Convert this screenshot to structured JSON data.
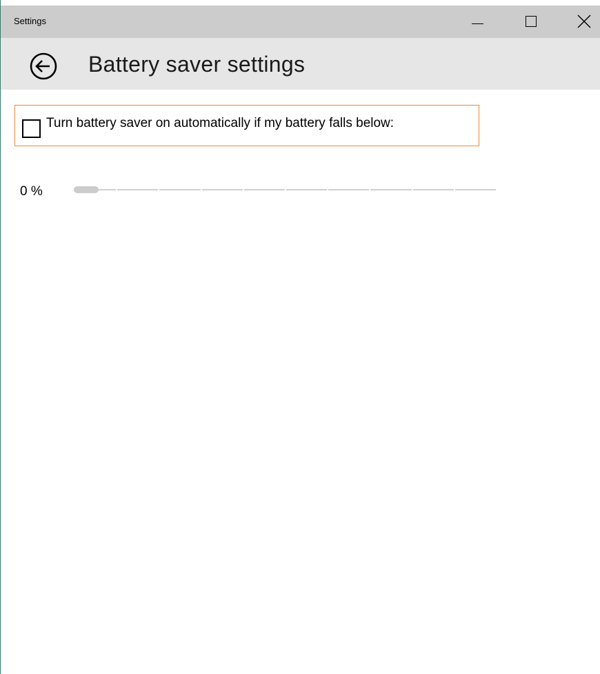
{
  "window": {
    "title": "Settings"
  },
  "header": {
    "title": "Battery saver settings"
  },
  "options": {
    "auto_on_label": "Turn battery saver on automatically if my battery falls below:",
    "auto_on_checked": false
  },
  "slider": {
    "value_label": "0 %",
    "value_percent": 0,
    "min": 0,
    "max": 100,
    "tick_step": 10
  },
  "colors": {
    "titlebar_bg": "#cccccc",
    "header_bg": "#e6e6e6",
    "focus_border": "#f0883a",
    "slider_track": "#cfcfcf",
    "slider_thumb": "#cccccc"
  }
}
